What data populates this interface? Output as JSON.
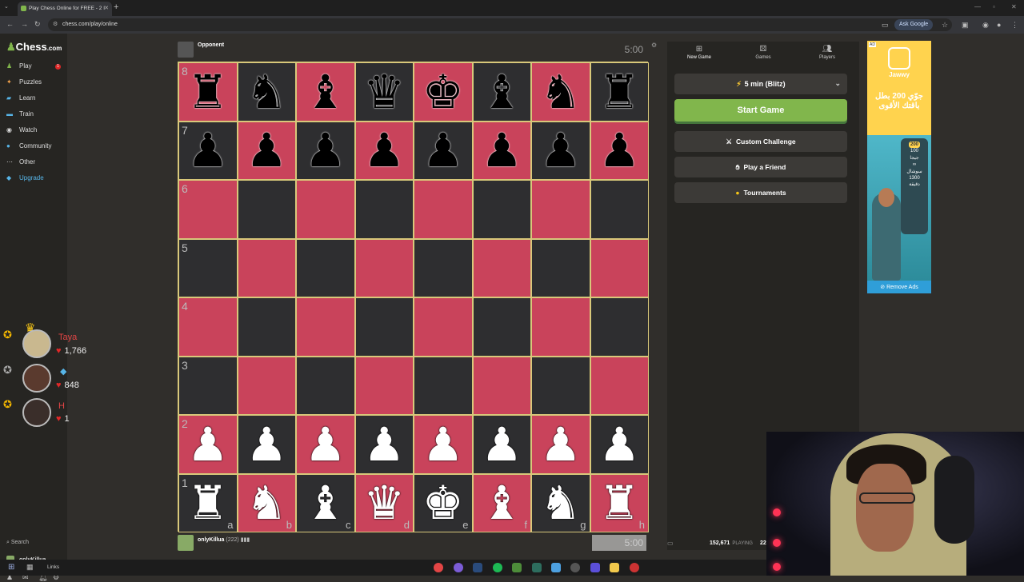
{
  "browser": {
    "tab_title": "Play Chess Online for FREE - 2 I",
    "url": "chess.com/play/online",
    "ask_google": "Ask Google"
  },
  "sidebar": {
    "logo": "Chess",
    "logo_suffix": ".com",
    "play_badge": "1",
    "items": [
      {
        "label": "Play",
        "icon": "pawn-icon",
        "color": "#81b64c"
      },
      {
        "label": "Puzzles",
        "icon": "puzzle-icon",
        "color": "#f7a44c"
      },
      {
        "label": "Learn",
        "icon": "learn-icon",
        "color": "#57b5e8"
      },
      {
        "label": "Train",
        "icon": "train-icon",
        "color": "#57b5e8"
      },
      {
        "label": "Watch",
        "icon": "watch-icon",
        "color": "#ddd"
      },
      {
        "label": "Community",
        "icon": "community-icon",
        "color": "#57b5e8"
      },
      {
        "label": "Other",
        "icon": "more-icon",
        "color": "#ddd"
      },
      {
        "label": "Upgrade",
        "icon": "diamond-icon",
        "color": "#57b5e8"
      }
    ],
    "search": "Search",
    "username": "onlyKillua"
  },
  "leaderboard": [
    {
      "name": "Taya",
      "score": "1,766"
    },
    {
      "name": "",
      "score": "848"
    },
    {
      "name": "H",
      "score": "1"
    }
  ],
  "game": {
    "opponent": "Opponent",
    "opponent_clock": "5:00",
    "player_name": "onlyKillua",
    "player_rating": "(222)",
    "player_clock": "5:00",
    "ranks": [
      "8",
      "7",
      "6",
      "5",
      "4",
      "3",
      "2",
      "1"
    ],
    "files": [
      "a",
      "b",
      "c",
      "d",
      "e",
      "f",
      "g",
      "h"
    ],
    "position": [
      [
        "♜",
        "♞",
        "♝",
        "♛",
        "♚",
        "♝",
        "♞",
        "♜"
      ],
      [
        "♟",
        "♟",
        "♟",
        "♟",
        "♟",
        "♟",
        "♟",
        "♟"
      ],
      [
        "",
        "",
        "",
        "",
        "",
        "",
        "",
        ""
      ],
      [
        "",
        "",
        "",
        "",
        "",
        "",
        "",
        ""
      ],
      [
        "",
        "",
        "",
        "",
        "",
        "",
        "",
        ""
      ],
      [
        "",
        "",
        "",
        "",
        "",
        "",
        "",
        ""
      ],
      [
        "♟",
        "♟",
        "♟",
        "♟",
        "♟",
        "♟",
        "♟",
        "♟"
      ],
      [
        "♜",
        "♞",
        "♝",
        "♛",
        "♚",
        "♝",
        "♞",
        "♜"
      ]
    ],
    "colors": {
      "light": "#c9435b",
      "dark": "#2e2e30"
    }
  },
  "panel": {
    "tabs": [
      {
        "label": "New Game",
        "icon": "plus-icon"
      },
      {
        "label": "Games",
        "icon": "games-icon"
      },
      {
        "label": "Players",
        "icon": "players-icon"
      }
    ],
    "time_control": "5 min (Blitz)",
    "start": "Start Game",
    "options": [
      {
        "label": "Custom Challenge",
        "icon": "custom-challenge-icon"
      },
      {
        "label": "Play a Friend",
        "icon": "friend-icon"
      },
      {
        "label": "Tournaments",
        "icon": "trophy-icon"
      }
    ],
    "playing_count": "152,671",
    "playing_label": "PLAYING",
    "games_count": "22"
  },
  "ad": {
    "tag": "AD",
    "brand": "Jawwy",
    "headline": "جوّي 200 بطل باقتك الأقوى",
    "card_lines": [
      "200",
      "100",
      "جيجا",
      "∞",
      "سوشال",
      "1300",
      "دقيقة"
    ],
    "remove": "Remove Ads"
  },
  "taskbar": {
    "links": "Links"
  }
}
